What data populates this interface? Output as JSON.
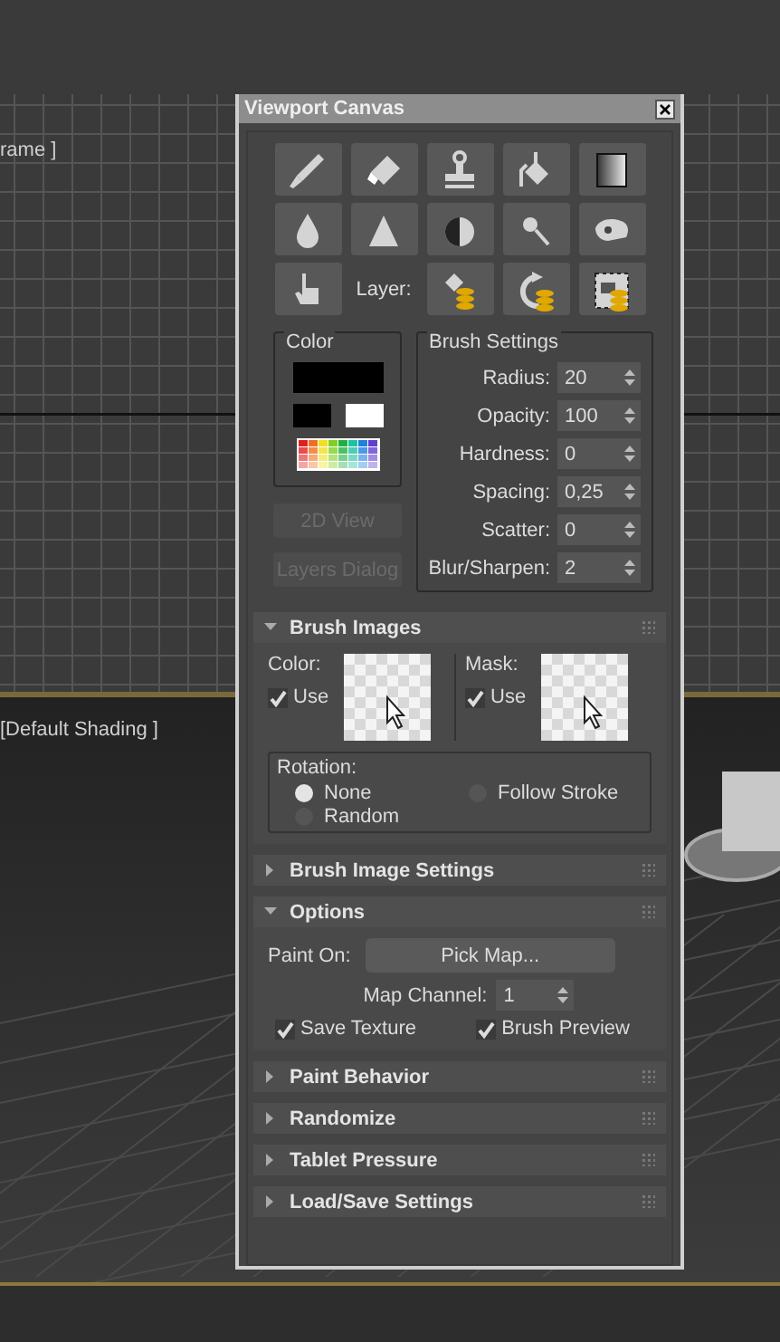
{
  "viewports": [
    {
      "label": "rame ]"
    },
    {
      "label": "[Default Shading ]"
    }
  ],
  "window": {
    "title": "Viewport Canvas"
  },
  "layer_label": "Layer:",
  "color_group": {
    "title": "Color",
    "swatches": [
      {
        "kind": "main",
        "color": "#000000"
      },
      {
        "kind": "small",
        "color": "#000000"
      },
      {
        "kind": "small",
        "color": "#ffffff"
      }
    ]
  },
  "side_buttons": [
    {
      "label": "2D View",
      "disabled": true
    },
    {
      "label": "Layers Dialog",
      "disabled": true
    }
  ],
  "brush_settings": {
    "title": "Brush Settings",
    "fields": [
      {
        "label": "Radius:",
        "value": "20"
      },
      {
        "label": "Opacity:",
        "value": "100"
      },
      {
        "label": "Hardness:",
        "value": "0"
      },
      {
        "label": "Spacing:",
        "value": "0,25"
      },
      {
        "label": "Scatter:",
        "value": "0"
      },
      {
        "label": "Blur/Sharpen:",
        "value": "2"
      }
    ]
  },
  "rollouts": [
    {
      "kind": "brush_images",
      "title": "Brush Images",
      "expanded": true,
      "images": [
        {
          "label": "Color:",
          "use": {
            "label": "Use",
            "checked": true
          }
        },
        {
          "label": "Mask:",
          "use": {
            "label": "Use",
            "checked": true
          }
        }
      ],
      "rotation": {
        "title": "Rotation:",
        "options": [
          {
            "label": "None",
            "selected": true
          },
          {
            "label": "Follow Stroke",
            "selected": false
          },
          {
            "label": "Random",
            "selected": false
          }
        ]
      }
    },
    {
      "kind": "plain",
      "title": "Brush Image Settings",
      "expanded": false
    },
    {
      "kind": "options",
      "title": "Options",
      "expanded": true,
      "paint_on_label": "Paint On:",
      "pick_map_button": "Pick Map...",
      "map_channel": {
        "label": "Map Channel:",
        "value": "1"
      },
      "checkboxes": [
        {
          "label": "Save Texture",
          "checked": true
        },
        {
          "label": "Brush Preview",
          "checked": true
        }
      ]
    },
    {
      "kind": "plain",
      "title": "Paint Behavior",
      "expanded": false
    },
    {
      "kind": "plain",
      "title": "Randomize",
      "expanded": false
    },
    {
      "kind": "plain",
      "title": "Tablet Pressure",
      "expanded": false
    },
    {
      "kind": "plain",
      "title": "Load/Save Settings",
      "expanded": false
    }
  ]
}
